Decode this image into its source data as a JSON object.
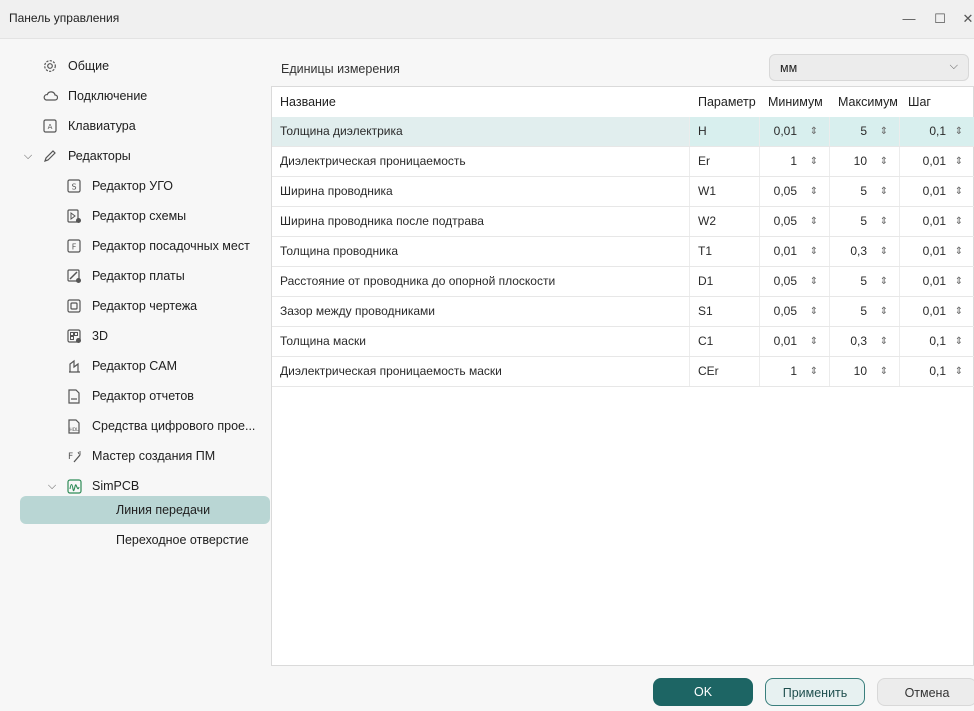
{
  "window": {
    "title": "Панель управления",
    "controls": {
      "minimize": "—",
      "maximize": "☐",
      "close": "✕"
    }
  },
  "sidebar": {
    "items": [
      {
        "label": "Общие",
        "icon": "gear-icon"
      },
      {
        "label": "Подключение",
        "icon": "cloud-icon"
      },
      {
        "label": "Клавиатура",
        "icon": "keyboard-icon"
      },
      {
        "label": "Редакторы",
        "icon": "pencil-icon",
        "expanded": true
      },
      {
        "label": "Редактор УГО",
        "icon": "symbol-editor-icon"
      },
      {
        "label": "Редактор схемы",
        "icon": "schematic-editor-icon"
      },
      {
        "label": "Редактор посадочных мест",
        "icon": "footprint-editor-icon"
      },
      {
        "label": "Редактор платы",
        "icon": "board-editor-icon"
      },
      {
        "label": "Редактор чертежа",
        "icon": "drawing-editor-icon"
      },
      {
        "label": "3D",
        "icon": "3d-icon"
      },
      {
        "label": "Редактор CAM",
        "icon": "cam-editor-icon"
      },
      {
        "label": "Редактор отчетов",
        "icon": "report-editor-icon"
      },
      {
        "label": "Средства цифрового прое...",
        "icon": "hdl-icon"
      },
      {
        "label": "Мастер создания ПМ",
        "icon": "wizard-icon"
      },
      {
        "label": "SimPCB",
        "icon": "simpcb-icon",
        "expanded": true
      },
      {
        "label": "Линия передачи",
        "selected": true
      },
      {
        "label": "Переходное отверстие"
      }
    ]
  },
  "units": {
    "label": "Единицы измерения",
    "value": "мм"
  },
  "table": {
    "headers": [
      "Название",
      "Параметр",
      "Минимум",
      "Максимум",
      "Шаг"
    ],
    "rows": [
      {
        "name": "Толщина диэлектрика",
        "param": "H",
        "min": "0,01",
        "max": "5",
        "step": "0,1"
      },
      {
        "name": "Диэлектрическая проницаемость",
        "param": "Er",
        "min": "1",
        "max": "10",
        "step": "0,01"
      },
      {
        "name": "Ширина проводника",
        "param": "W1",
        "min": "0,05",
        "max": "5",
        "step": "0,01"
      },
      {
        "name": "Ширина проводника после подтрава",
        "param": "W2",
        "min": "0,05",
        "max": "5",
        "step": "0,01"
      },
      {
        "name": "Толщина проводника",
        "param": "T1",
        "min": "0,01",
        "max": "0,3",
        "step": "0,01"
      },
      {
        "name": "Расстояние от проводника до опорной плоскости",
        "param": "D1",
        "min": "0,05",
        "max": "5",
        "step": "0,01"
      },
      {
        "name": "Зазор между проводниками",
        "param": "S1",
        "min": "0,05",
        "max": "5",
        "step": "0,01"
      },
      {
        "name": "Толщина маски",
        "param": "C1",
        "min": "0,01",
        "max": "0,3",
        "step": "0,1"
      },
      {
        "name": "Диэлектрическая проницаемость маски",
        "param": "CEr",
        "min": "1",
        "max": "10",
        "step": "0,1"
      }
    ]
  },
  "buttons": {
    "ok": "OK",
    "apply": "Применить",
    "cancel": "Отмена"
  },
  "colors": {
    "accent": "#1d6564",
    "selected_nav": "#b9d6d4",
    "selected_row": "#e1eeee"
  }
}
